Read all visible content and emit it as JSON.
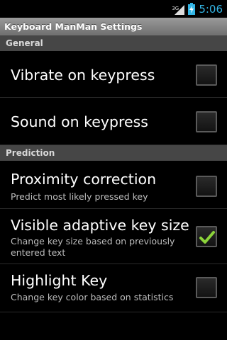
{
  "status_bar": {
    "network_type": "3G",
    "time": "5:06",
    "icons": [
      "signal-icon",
      "battery-charging-icon"
    ]
  },
  "title": "Keyboard ManMan Settings",
  "sections": {
    "general": {
      "label": "General",
      "items": [
        {
          "title": "Vibrate on keypress",
          "summary": "",
          "checked": false
        },
        {
          "title": "Sound on keypress",
          "summary": "",
          "checked": false
        }
      ]
    },
    "prediction": {
      "label": "Prediction",
      "items": [
        {
          "title": "Proximity correction",
          "summary": "Predict most likely pressed key",
          "checked": false
        },
        {
          "title": "Visible adaptive key size",
          "summary": "Change key size based on previously entered text",
          "checked": true
        },
        {
          "title": "Highlight Key",
          "summary": "Change key color based on statistics",
          "checked": false
        }
      ]
    }
  },
  "colors": {
    "accent": "#33b5e5",
    "check": "#8cd43a",
    "section_bg": "#464646"
  }
}
